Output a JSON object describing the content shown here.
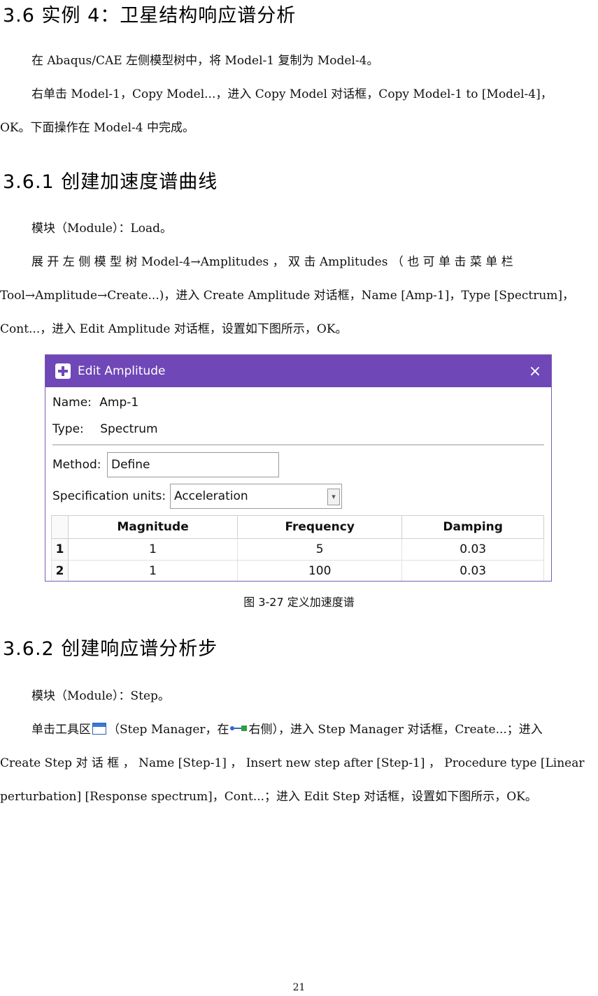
{
  "heading_main": "3.6  实例 4：卫星结构响应谱分析",
  "intro": {
    "p1": "在 Abaqus/CAE 左侧模型树中，将 Model-1 复制为 Model-4。",
    "p2a": "右单击 Model-1，Copy Model...，进入 Copy Model 对话框，Copy Model-1 to [Model-4]，",
    "p2b": "OK。下面操作在 Model-4 中完成。"
  },
  "section1": {
    "heading": "3.6.1  创建加速度谱曲线",
    "p1": "模块（Module）：Load。",
    "p2a": "展 开 左 侧 模 型 树  Model-4→Amplitudes ， 双 击  Amplitudes （ 也 可 单 击 菜 单 栏",
    "p2b": "Tool→Amplitude→Create...)，进入 Create Amplitude 对话框，Name [Amp-1]，Type [Spectrum]，",
    "p2c": "Cont...，进入 Edit Amplitude 对话框，设置如下图所示，OK。"
  },
  "dialog": {
    "title": "Edit Amplitude",
    "close_icon": "×",
    "name_label": "Name:",
    "name_value": "Amp-1",
    "type_label": "Type:",
    "type_value": "Spectrum",
    "method_label": "Method:",
    "method_value": "Define",
    "units_label": "Specification units:",
    "units_value": "Acceleration",
    "table": {
      "headers": [
        "Magnitude",
        "Frequency",
        "Damping"
      ],
      "rows": [
        {
          "index": "1",
          "cells": [
            "1",
            "5",
            "0.03"
          ]
        },
        {
          "index": "2",
          "cells": [
            "1",
            "100",
            "0.03"
          ]
        }
      ]
    }
  },
  "caption": "图 3-27   定义加速度谱",
  "section2": {
    "heading": "3.6.2  创建响应谱分析步",
    "p1": "模块（Module）：Step。",
    "p2a_before_icon": "单击工具区",
    "p2a_mid": "（Step Manager，在",
    "p2a_after": "右侧），进入 Step Manager 对话框，Create...；进入",
    "p2b": "Create Step 对 话 框 ， Name [Step-1] ， Insert new step after [Step-1] ， Procedure type [Linear",
    "p2c": "perturbation] [Response spectrum]，Cont...；进入 Edit Step 对话框，设置如下图所示，OK。"
  },
  "page_number": "21"
}
